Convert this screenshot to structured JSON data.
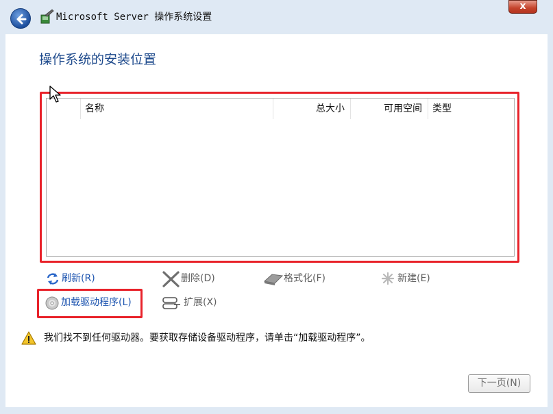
{
  "window": {
    "title": "Microsoft Server 操作系统设置",
    "close_label": "x"
  },
  "page": {
    "heading": "操作系统的安装位置"
  },
  "table": {
    "columns": [
      "名称",
      "总大小",
      "可用空间",
      "类型"
    ],
    "rows": []
  },
  "actions": {
    "refresh": "刷新(R)",
    "delete": "删除(D)",
    "format": "格式化(F)",
    "new": "新建(E)",
    "load_driver": "加载驱动程序(L)",
    "extend": "扩展(X)"
  },
  "warning": {
    "text": "我们找不到任何驱动器。要获取存储设备驱动程序，请单击“加载驱动程序”。"
  },
  "footer": {
    "next_label": "下一页(N)"
  },
  "colors": {
    "accent": "#1e55b0",
    "highlight": "#e8222a",
    "title_bg": "#dfe9f4"
  }
}
